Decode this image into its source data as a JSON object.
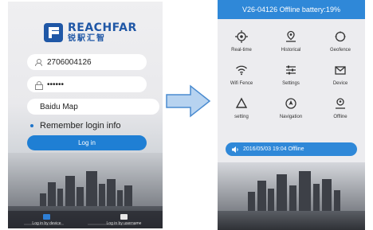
{
  "login": {
    "logo_en": "REACHFAR",
    "logo_cn": "锐駅汇智",
    "account": "2706004126",
    "password": "••••••",
    "map": "Baidu Map",
    "remember": "Remember login info",
    "login_button": "Log in",
    "tabs": [
      "Log in by device",
      "Log in by username"
    ]
  },
  "status": {
    "text": "V26-04126 Offline battery:19%"
  },
  "menu": {
    "items": [
      {
        "label": "Real-time",
        "icon": "target-icon"
      },
      {
        "label": "Historical",
        "icon": "map-pin-icon"
      },
      {
        "label": "Geofence",
        "icon": "geofence-circle-icon"
      },
      {
        "label": "Wifi Fence",
        "icon": "wifi-icon"
      },
      {
        "label": "Settings",
        "icon": "settings-sliders-icon"
      },
      {
        "label": "Device",
        "icon": "mail-icon"
      },
      {
        "label": "setting",
        "icon": "triangle-icon"
      },
      {
        "label": "Navigation",
        "icon": "navigation-icon"
      },
      {
        "label": "Offline",
        "icon": "person-pin-icon"
      }
    ]
  },
  "banner": {
    "text": "2016/05/03 19:04 Offline"
  },
  "colors": {
    "accent": "#2f88d8",
    "brand": "#1f57a6"
  }
}
